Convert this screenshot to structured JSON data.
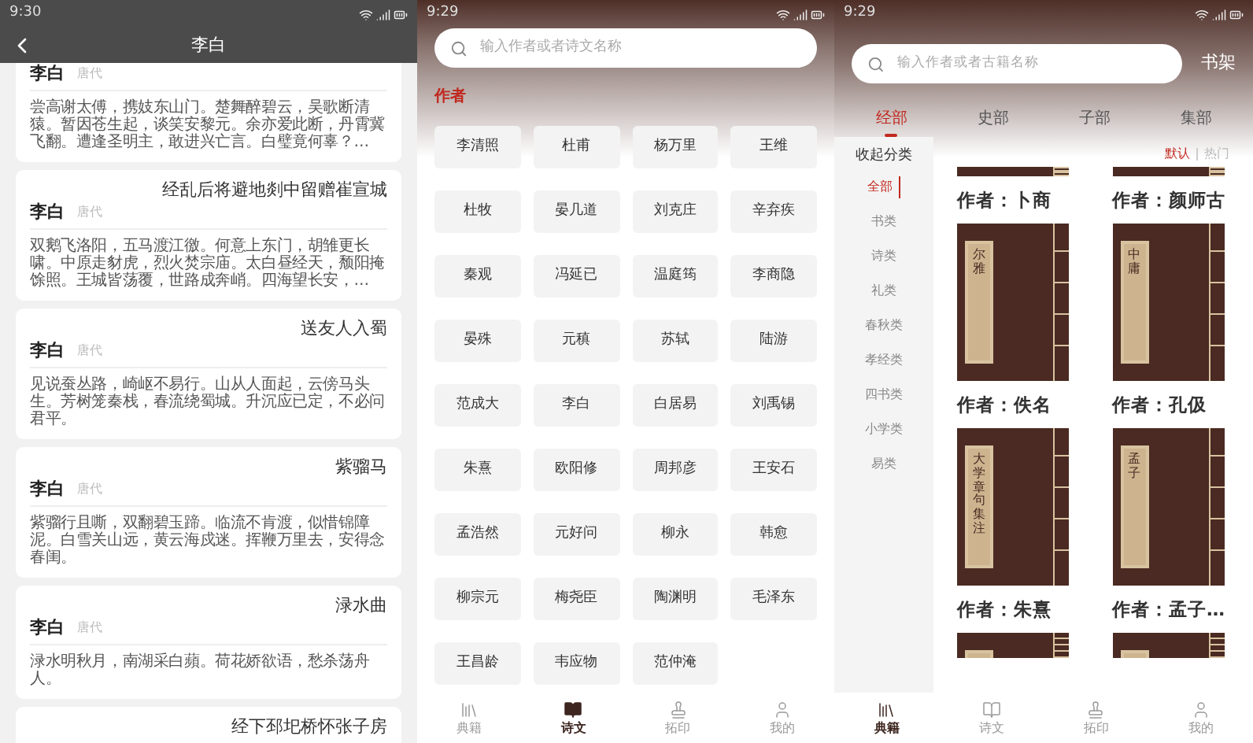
{
  "poem_screen": {
    "status_bar": {
      "time": "9:30"
    },
    "header": {
      "title": "李白"
    },
    "poems": [
      {
        "author": "李白",
        "dynasty": "唐代",
        "text": "尝高谢太傅，携妓东山门。楚舞醉碧云，吴歌断清猿。暂因苍生起，谈笑安黎元。余亦爱此断，丹霄冀飞翻。遭逢圣明主，敢进兴亡言。白璧竟何辜？…"
      },
      {
        "title": "经乱后将避地剡中留赠崔宣城",
        "author": "李白",
        "dynasty": "唐代",
        "text": "双鹅飞洛阳，五马渡江徼。何意上东门，胡雏更长啸。中原走豺虎，烈火焚宗庙。太白昼经天，颓阳掩馀照。王城皆荡覆，世路成奔峭。四海望长安，…"
      },
      {
        "title": "送友人入蜀",
        "author": "李白",
        "dynasty": "唐代",
        "text": "见说蚕丛路，崎岖不易行。山从人面起，云傍马头生。芳树笼秦栈，春流绕蜀城。升沉应已定，不必问君平。"
      },
      {
        "title": "紫骝马",
        "author": "李白",
        "dynasty": "唐代",
        "text": "紫骝行且嘶，双翻碧玉蹄。临流不肯渡，似惜锦障泥。白雪关山远，黄云海戍迷。挥鞭万里去，安得念春闺。"
      },
      {
        "title": "渌水曲",
        "author": "李白",
        "dynasty": "唐代",
        "text": "渌水明秋月，南湖采白蘋。荷花娇欲语，愁杀荡舟人。"
      },
      {
        "title": "经下邳圯桥怀张子房"
      }
    ]
  },
  "authors_screen": {
    "status_bar": {
      "time": "9:29"
    },
    "search": {
      "placeholder": "输入作者或者诗文名称"
    },
    "section_title": "作者",
    "authors": [
      "李清照",
      "杜甫",
      "杨万里",
      "王维",
      "杜牧",
      "晏几道",
      "刘克庄",
      "辛弃疾",
      "秦观",
      "冯延已",
      "温庭筠",
      "李商隐",
      "晏殊",
      "元稹",
      "苏轼",
      "陆游",
      "范成大",
      "李白",
      "白居易",
      "刘禹锡",
      "朱熹",
      "欧阳修",
      "周邦彦",
      "王安石",
      "孟浩然",
      "元好问",
      "柳永",
      "韩愈",
      "柳宗元",
      "梅尧臣",
      "陶渊明",
      "毛泽东",
      "王昌龄",
      "韦应物",
      "范仲淹"
    ],
    "bottom_nav": [
      {
        "label": "典籍",
        "kind": "books",
        "selected": false
      },
      {
        "label": "诗文",
        "kind": "book",
        "selected": true
      },
      {
        "label": "拓印",
        "kind": "stamp",
        "selected": false
      },
      {
        "label": "我的",
        "kind": "user",
        "selected": false
      }
    ]
  },
  "classics_screen": {
    "status_bar": {
      "time": "9:29"
    },
    "search": {
      "placeholder": "输入作者或者古籍名称"
    },
    "shelf_link": "书架",
    "tabs": [
      {
        "label": "经部",
        "selected": true
      },
      {
        "label": "史部",
        "selected": false
      },
      {
        "label": "子部",
        "selected": false
      },
      {
        "label": "集部",
        "selected": false
      }
    ],
    "collapse_label": "收起分类",
    "categories": [
      {
        "label": "全部",
        "selected": true
      },
      {
        "label": "书类",
        "selected": false
      },
      {
        "label": "诗类",
        "selected": false
      },
      {
        "label": "礼类",
        "selected": false
      },
      {
        "label": "春秋类",
        "selected": false
      },
      {
        "label": "孝经类",
        "selected": false
      },
      {
        "label": "四书类",
        "selected": false
      },
      {
        "label": "小学类",
        "selected": false
      },
      {
        "label": "易类",
        "selected": false
      }
    ],
    "sort_options": [
      {
        "label": "默认",
        "selected": true
      },
      {
        "label": "热门",
        "selected": false
      }
    ],
    "books": [
      {
        "kind": "cover_bottom",
        "author": "作者：卜商"
      },
      {
        "kind": "cover_bottom",
        "author": "作者：颜师古"
      },
      {
        "kind": "full",
        "title": "尔雅",
        "author": "作者：佚名"
      },
      {
        "kind": "full",
        "title": "中庸",
        "author": "作者：孔伋"
      },
      {
        "kind": "full",
        "title": "大学章句集注",
        "author": "作者：朱熹"
      },
      {
        "kind": "full",
        "title": "孟子",
        "author": "作者：孟子…"
      },
      {
        "kind": "cover_top"
      },
      {
        "kind": "cover_top"
      }
    ],
    "bottom_nav": [
      {
        "label": "典籍",
        "kind": "books",
        "selected": true
      },
      {
        "label": "诗文",
        "kind": "book",
        "selected": false
      },
      {
        "label": "拓印",
        "kind": "stamp",
        "selected": false
      },
      {
        "label": "我的",
        "kind": "user",
        "selected": false
      }
    ]
  }
}
